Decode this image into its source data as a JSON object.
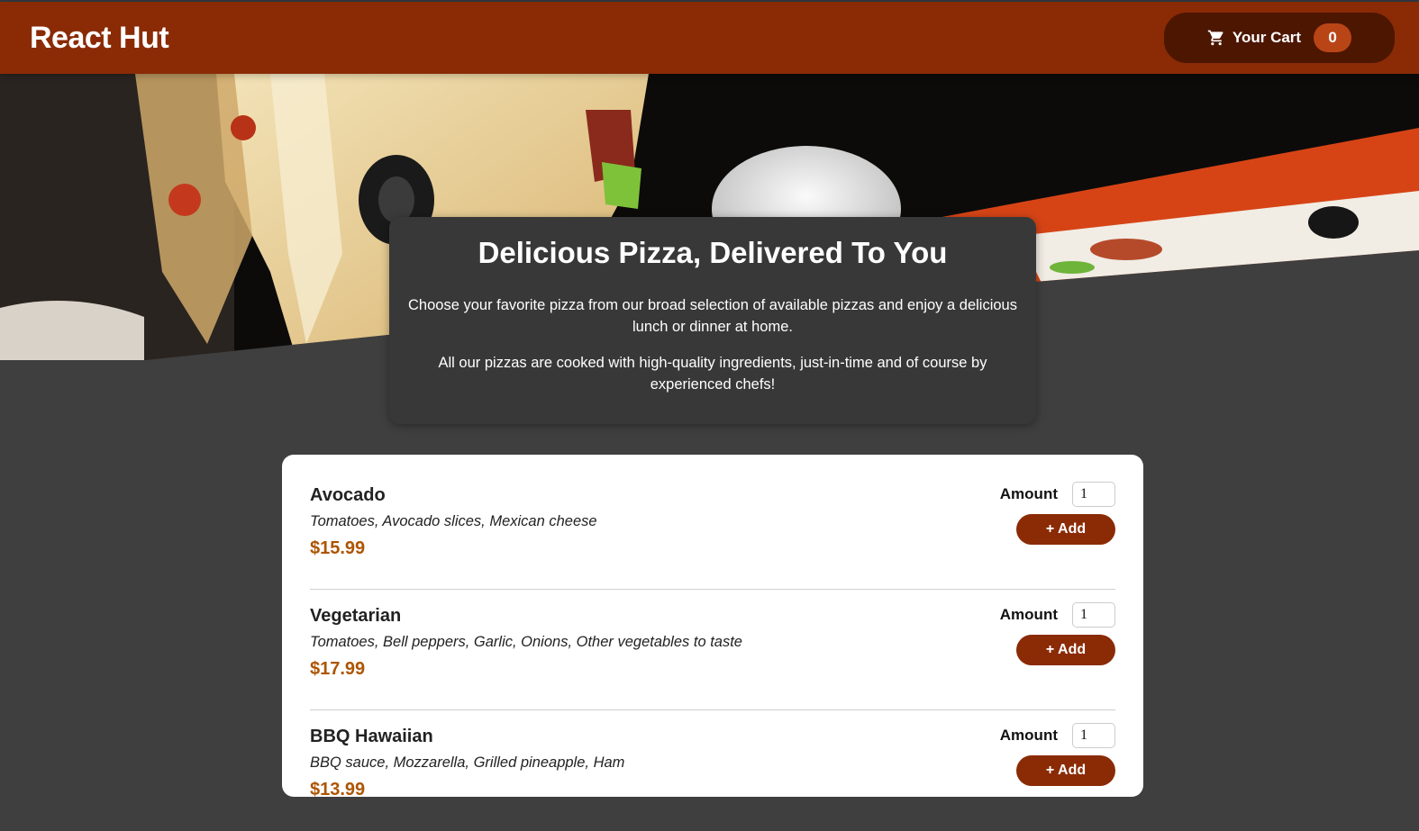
{
  "header": {
    "brand": "React Hut",
    "cart_label": "Your Cart",
    "cart_count": "0",
    "accent_color": "#8a2b06"
  },
  "summary": {
    "title": "Delicious Pizza, Delivered To You",
    "paragraph_1": "Choose your favorite pizza from our broad selection of available pizzas and enjoy a delicious lunch or dinner at home.",
    "paragraph_2": "All our pizzas are cooked with high-quality ingredients, just-in-time and of course by experienced chefs!"
  },
  "meals": [
    {
      "name": "Avocado",
      "description": "Tomatoes, Avocado slices, Mexican cheese",
      "price": "$15.99",
      "amount_label": "Amount",
      "amount_value": "1",
      "add_label": "+ Add"
    },
    {
      "name": "Vegetarian",
      "description": "Tomatoes, Bell peppers, Garlic, Onions, Other vegetables to taste",
      "price": "$17.99",
      "amount_label": "Amount",
      "amount_value": "1",
      "add_label": "+ Add"
    },
    {
      "name": "BBQ Hawaiian",
      "description": "BBQ sauce, Mozzarella, Grilled pineapple, Ham",
      "price": "$13.99",
      "amount_label": "Amount",
      "amount_value": "1",
      "add_label": "+ Add"
    }
  ]
}
